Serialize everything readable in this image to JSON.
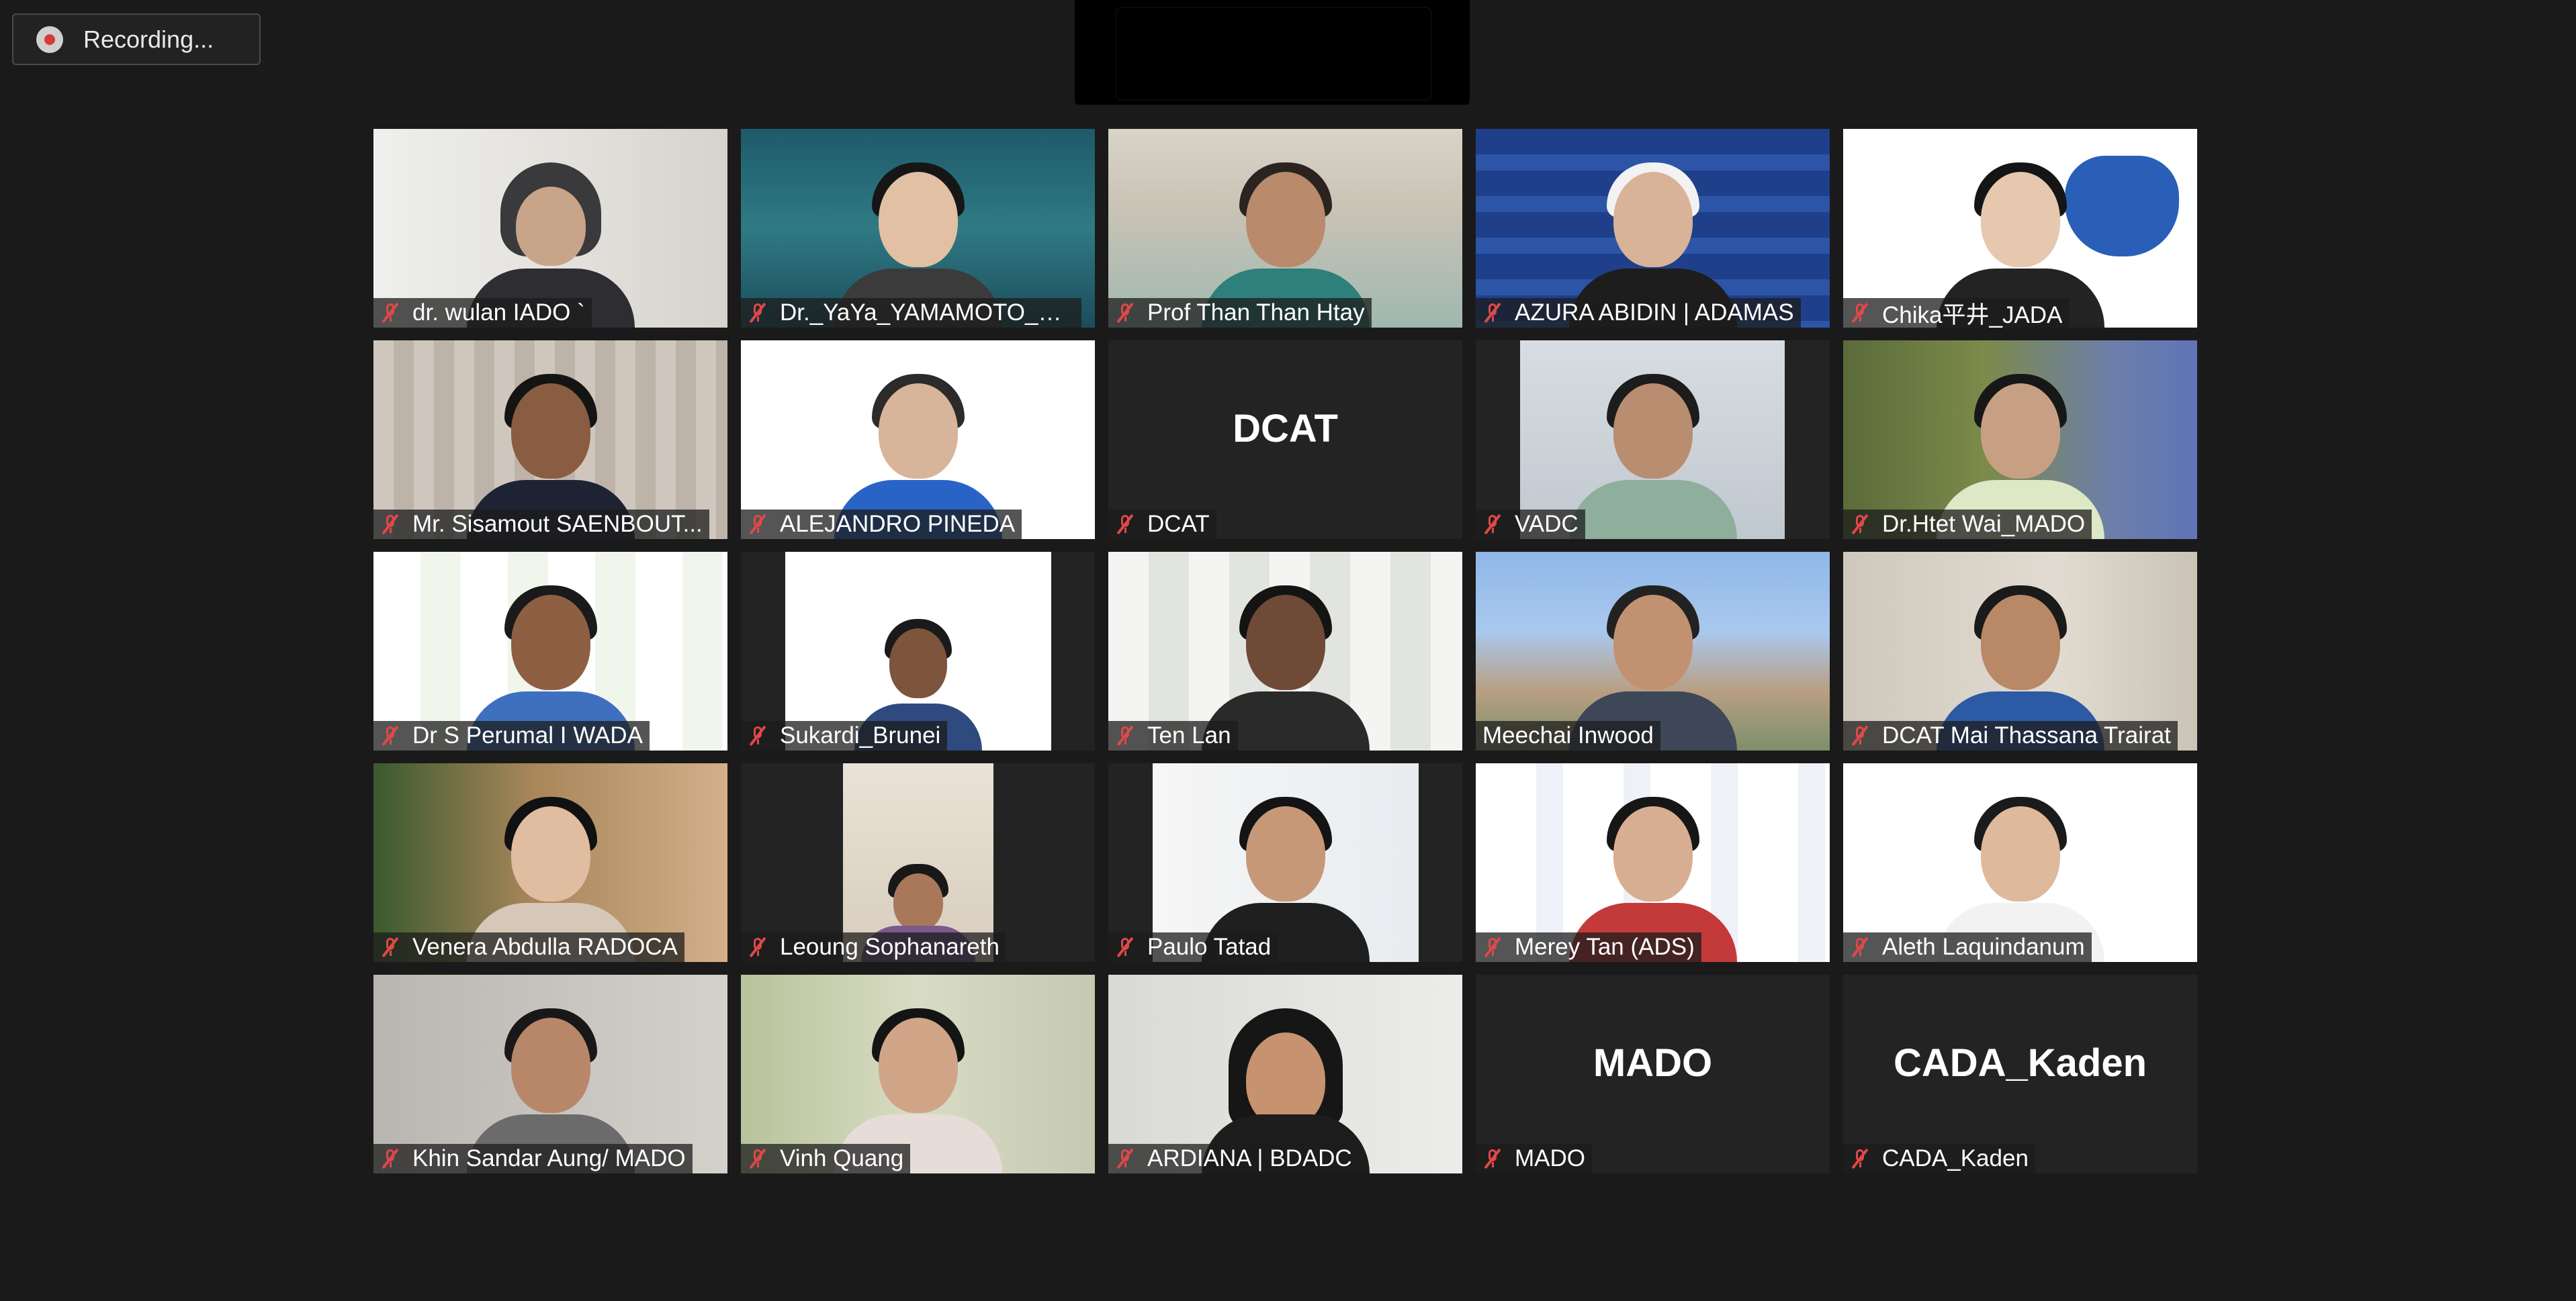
{
  "recording": {
    "label": "Recording..."
  },
  "participants": [
    {
      "name": "dr. wulan IADO `",
      "muted": true
    },
    {
      "name": "Dr._YaYa_YAMAMOTO_W...",
      "muted": true
    },
    {
      "name": "Prof Than Than Htay",
      "muted": true
    },
    {
      "name": "AZURA ABIDIN | ADAMAS",
      "muted": true
    },
    {
      "name": "Chika平井_JADA",
      "muted": true
    },
    {
      "name": "Mr. Sisamout SAENBOUT...",
      "muted": true
    },
    {
      "name": "ALEJANDRO PINEDA",
      "muted": true
    },
    {
      "name": "DCAT",
      "muted": true,
      "avatar_text": "DCAT"
    },
    {
      "name": "VADC",
      "muted": true
    },
    {
      "name": "Dr.Htet Wai_MADO",
      "muted": true
    },
    {
      "name": "Dr S Perumal I WADA",
      "muted": true
    },
    {
      "name": "Sukardi_Brunei",
      "muted": true
    },
    {
      "name": "Ten Lan",
      "muted": true
    },
    {
      "name": "Meechai Inwood",
      "muted": false
    },
    {
      "name": "DCAT Mai Thassana Trairat",
      "muted": true
    },
    {
      "name": "Venera Abdulla RADOCA",
      "muted": true
    },
    {
      "name": "Leoung Sophanareth",
      "muted": true
    },
    {
      "name": "Paulo Tatad",
      "muted": true
    },
    {
      "name": "Merey Tan (ADS)",
      "muted": true
    },
    {
      "name": "Aleth Laquindanum",
      "muted": true
    },
    {
      "name": "Khin Sandar Aung/ MADO",
      "muted": true
    },
    {
      "name": "Vinh Quang",
      "muted": true
    },
    {
      "name": "ARDIANA | BDADC",
      "muted": true
    },
    {
      "name": "MADO",
      "muted": true,
      "avatar_text": "MADO"
    },
    {
      "name": "CADA_Kaden",
      "muted": true,
      "avatar_text": "CADA_Kaden"
    }
  ],
  "colors": {
    "background": "#1a1a1a",
    "tile_empty": "#232323",
    "muted_icon": "#e04848",
    "name_text": "#ffffff"
  }
}
